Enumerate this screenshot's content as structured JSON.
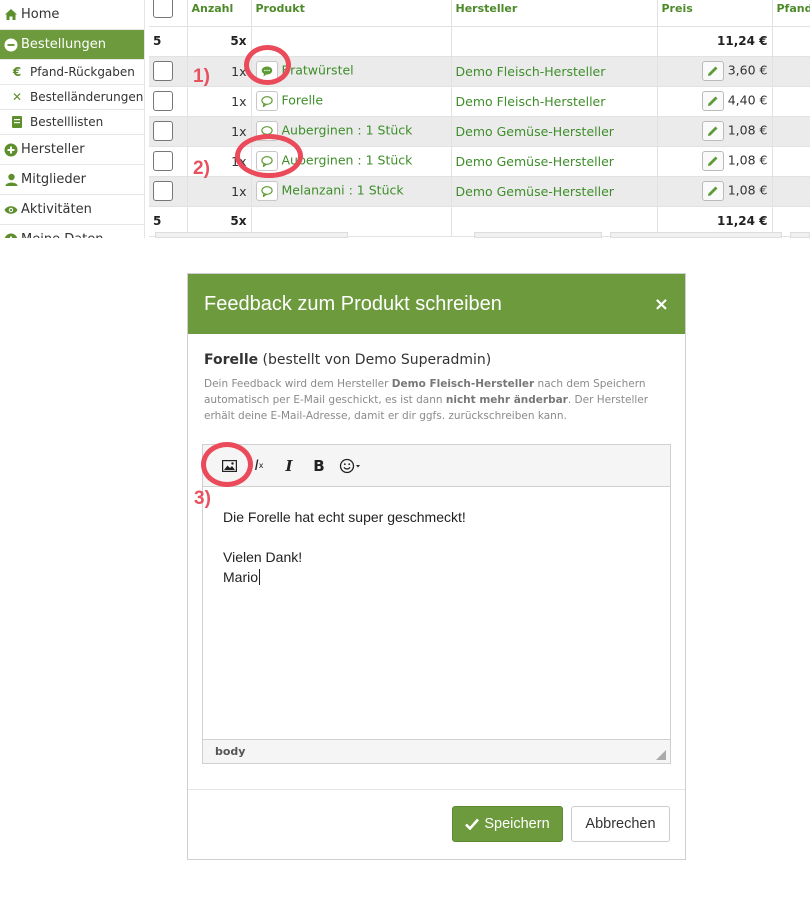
{
  "sidebar": {
    "items": [
      {
        "label": "Home",
        "icon": "home-icon"
      },
      {
        "label": "Bestellungen",
        "icon": "minus-circle-icon"
      },
      {
        "label": "Pfand-Rückgaben",
        "icon": "euro-icon"
      },
      {
        "label": "Bestelländerungen",
        "icon": "x-icon"
      },
      {
        "label": "Bestelllisten",
        "icon": "book-icon"
      },
      {
        "label": "Hersteller",
        "icon": "plus-circle-icon"
      },
      {
        "label": "Mitglieder",
        "icon": "user-icon"
      },
      {
        "label": "Aktivitäten",
        "icon": "eye-icon"
      },
      {
        "label": "Meine Daten",
        "icon": "plus-circle-icon"
      }
    ]
  },
  "table": {
    "headers": {
      "anzahl": "Anzahl",
      "produkt": "Produkt",
      "hersteller": "Hersteller",
      "preis": "Preis",
      "pfand": "Pfand"
    },
    "summary_top": {
      "count": "5",
      "qty": "5x",
      "total": "11,24 €"
    },
    "rows": [
      {
        "qty": "1x",
        "product": "Bratwürstel",
        "maker": "Demo Fleisch-Hersteller",
        "price": "3,60 €"
      },
      {
        "qty": "1x",
        "product": "Forelle",
        "maker": "Demo Fleisch-Hersteller",
        "price": "4,40 €"
      },
      {
        "qty": "1x",
        "product": "Auberginen : 1 Stück",
        "maker": "Demo Gemüse-Hersteller",
        "price": "1,08 €"
      },
      {
        "qty": "1x",
        "product": "Auberginen : 1 Stück",
        "maker": "Demo Gemüse-Hersteller",
        "price": "1,08 €"
      },
      {
        "qty": "1x",
        "product": "Melanzani : 1 Stück",
        "maker": "Demo Gemüse-Hersteller",
        "price": "1,08 €"
      }
    ],
    "summary_bottom": {
      "count": "5",
      "qty": "5x",
      "total": "11,24 €"
    }
  },
  "markers": [
    "1)",
    "2)",
    "3)"
  ],
  "modal": {
    "title": "Feedback zum Produkt schreiben",
    "close": "×",
    "product_name": "Forelle",
    "product_suffix": " (bestellt von Demo Superadmin)",
    "info_1": "Dein Feedback wird dem Hersteller ",
    "info_maker": "Demo Fleisch-Hersteller",
    "info_2": " nach dem Speichern automatisch per E-Mail geschickt, es ist dann ",
    "info_bold": "nicht mehr änderbar",
    "info_3": ". Der Hersteller erhält deine E-Mail-Adresse, damit er dir ggfs. zurückschreiben kann.",
    "editor": {
      "lines": [
        "Die Forelle hat echt super geschmeckt!",
        "",
        "Vielen Dank!",
        "Mario"
      ],
      "status": "body"
    },
    "save_label": "Speichern",
    "cancel_label": "Abbrechen"
  }
}
